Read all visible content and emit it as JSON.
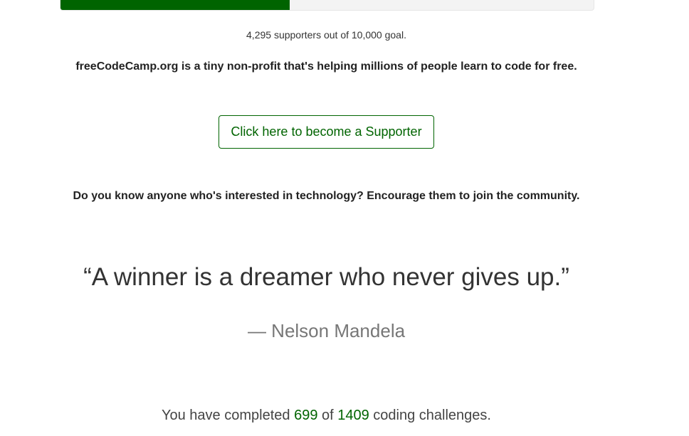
{
  "progress": {
    "fraction": 0.4295,
    "fill_color": "#006400"
  },
  "supporters_text": "4,295 supporters out of 10,000 goal.",
  "mission_text": "freeCodeCamp.org is a tiny non-profit that's helping millions of people learn to code for free.",
  "supporter_button": "Click here to become a Supporter",
  "encourage_text": "Do you know anyone who's interested in technology? Encourage them to join the community.",
  "quote": {
    "text": "“A winner is a dreamer who never gives up.”",
    "author": "— Nelson Mandela"
  },
  "completion": {
    "prefix": "You have completed ",
    "completed": "699",
    "middle": " of ",
    "total": "1409",
    "suffix": " coding challenges."
  }
}
